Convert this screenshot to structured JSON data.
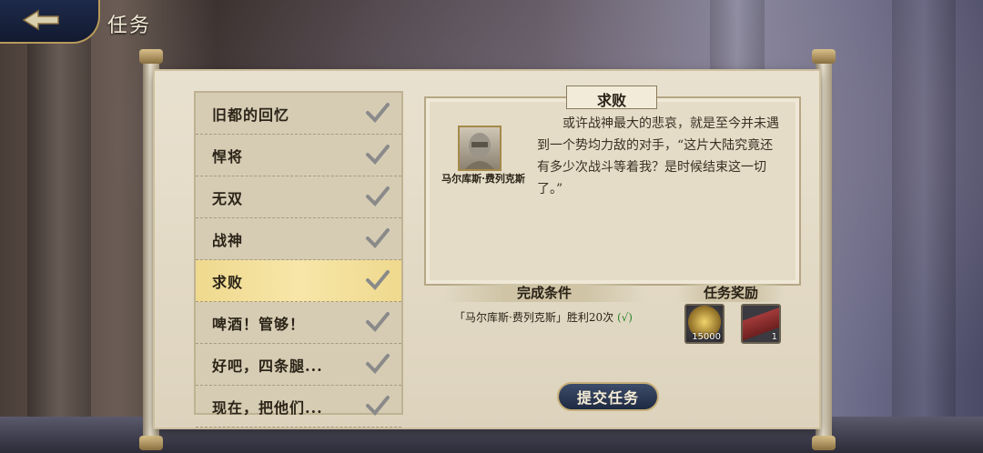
{
  "header": {
    "title": "任务"
  },
  "quests": [
    {
      "label": "旧都的回忆",
      "completed": true,
      "active": false
    },
    {
      "label": "悍将",
      "completed": true,
      "active": false
    },
    {
      "label": "无双",
      "completed": true,
      "active": false
    },
    {
      "label": "战神",
      "completed": true,
      "active": false
    },
    {
      "label": "求败",
      "completed": true,
      "active": true
    },
    {
      "label": "啤酒！管够！",
      "completed": true,
      "active": false
    },
    {
      "label": "好吧，四条腿...",
      "completed": true,
      "active": false
    },
    {
      "label": "现在，把他们...",
      "completed": true,
      "active": false
    }
  ],
  "detail": {
    "title": "求败",
    "character_name": "马尔库斯·费列克斯",
    "story": "或许战神最大的悲哀，就是至今并未遇到一个势均力敌的对手，“这片大陆究竟还有多少次战斗等着我？是时候结束这一切了。”"
  },
  "condition": {
    "header": "完成条件",
    "text": "「马尔库斯·费列克斯」胜利20次",
    "status": "(√)"
  },
  "rewards": {
    "header": "任务奖励",
    "items": [
      {
        "icon": "gold-coins-icon",
        "count": "15000"
      },
      {
        "icon": "red-cape-icon",
        "count": "1"
      }
    ]
  },
  "actions": {
    "submit_label": "提交任务"
  },
  "colors": {
    "active_row": "#f7e6a8",
    "check_mark": "#8a8a8a",
    "button_bg": "#1f2a42",
    "gold_trim": "#c7b07a"
  }
}
